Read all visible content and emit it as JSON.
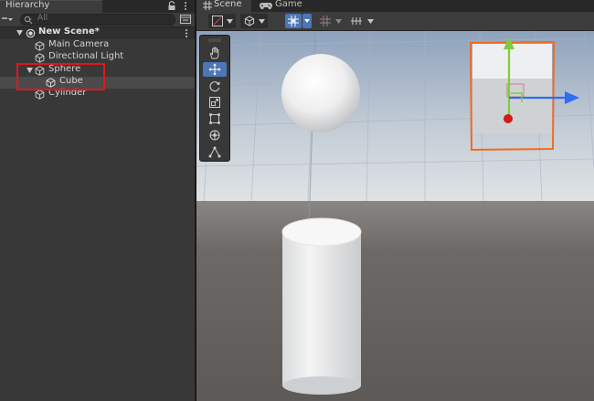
{
  "hierarchy": {
    "tab_label": "Hierarchy",
    "search_placeholder": "All",
    "scene_name": "New Scene*",
    "items": [
      {
        "label": "Main Camera"
      },
      {
        "label": "Directional Light"
      },
      {
        "label": "Sphere"
      },
      {
        "label": "Cube"
      },
      {
        "label": "Cylinder"
      }
    ]
  },
  "scene_view": {
    "tabs": [
      {
        "label": "Scene"
      },
      {
        "label": "Game"
      }
    ],
    "active_tool": "move",
    "tools": [
      "hand-icon",
      "move-icon",
      "rotate-icon",
      "scale-icon",
      "rect-icon",
      "transform-icon",
      "custom-tool-icon"
    ],
    "selected_object": "Cube"
  },
  "colors": {
    "selection_outline": "#f26a21",
    "highlight_box": "#e3161b",
    "gizmo_y": "#7dce3b",
    "gizmo_x": "#2f6df2",
    "gizmo_z": "#d11a1a",
    "active_tool": "#4c76b6"
  }
}
